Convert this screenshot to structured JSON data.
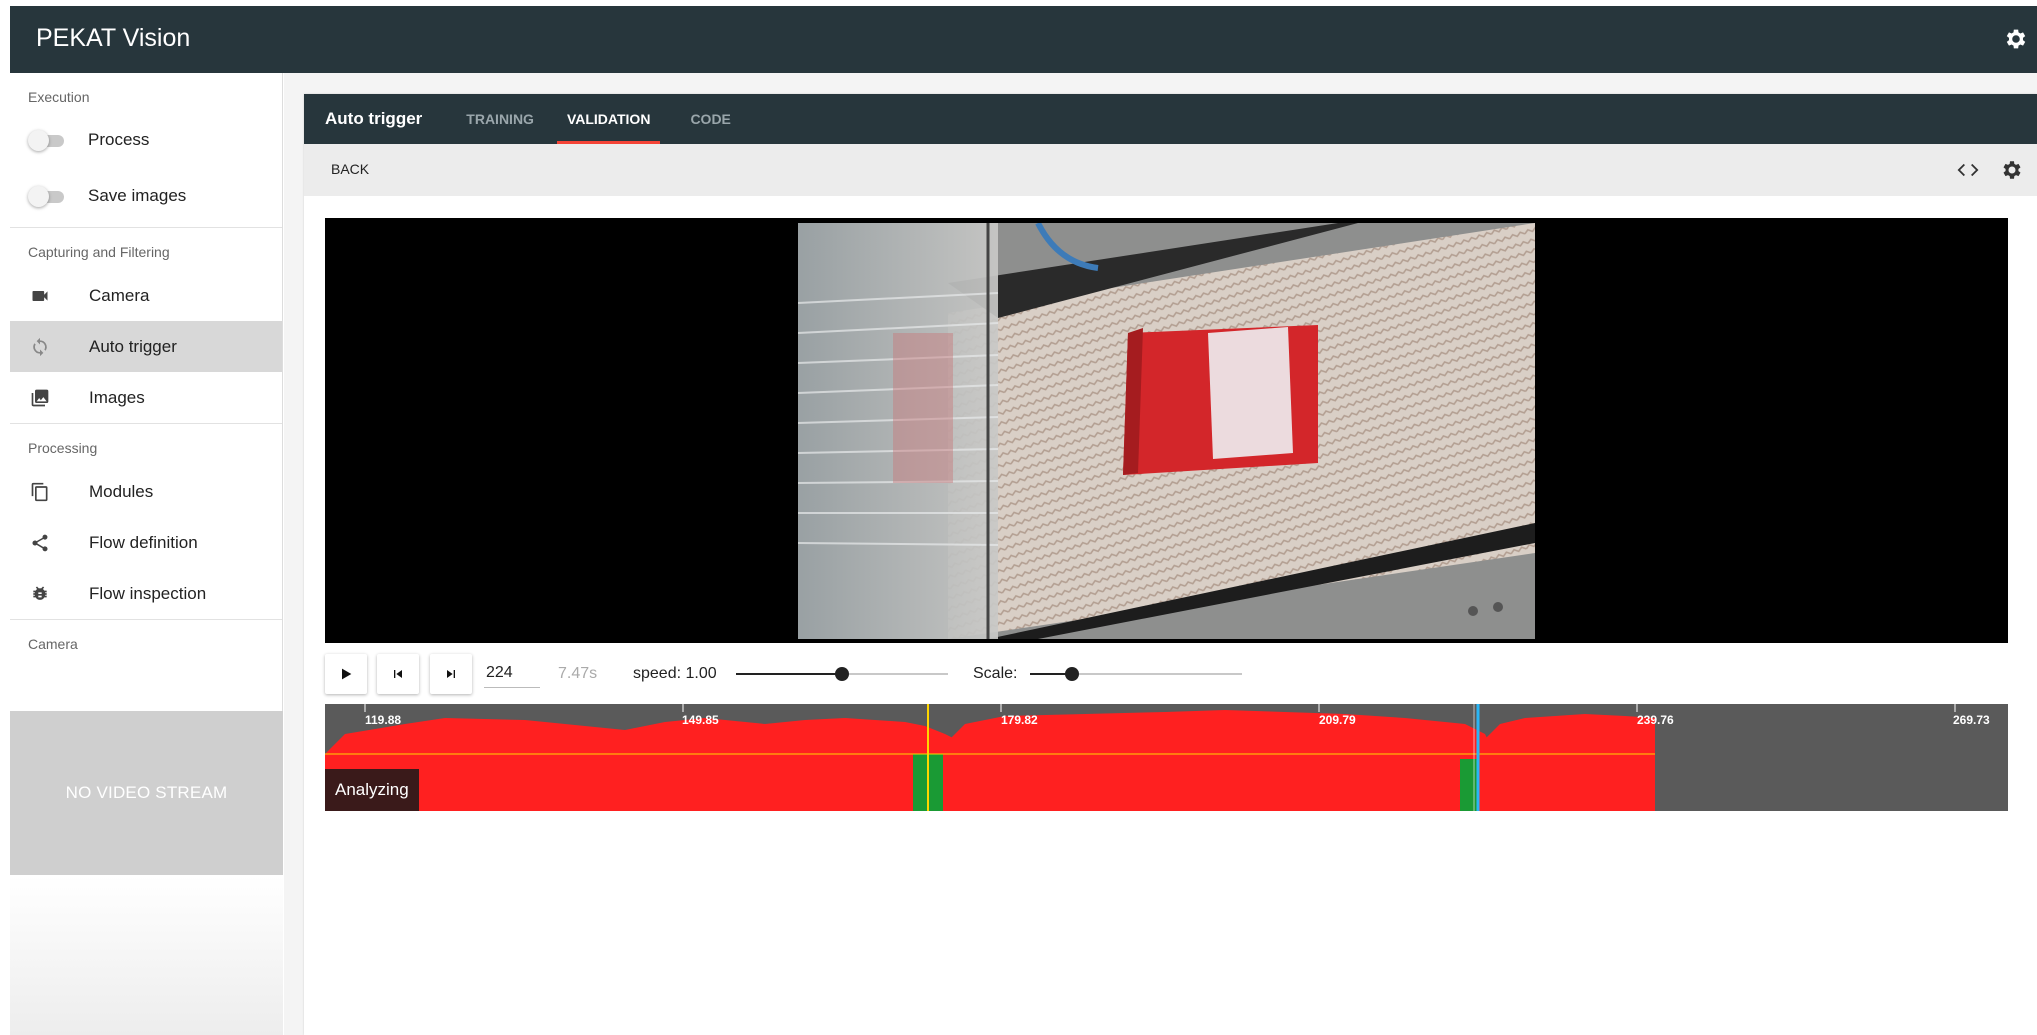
{
  "app": {
    "title": "PEKAT Vision"
  },
  "sidebar": {
    "sections": [
      {
        "title": "Execution"
      },
      {
        "title": "Capturing and Filtering"
      },
      {
        "title": "Processing"
      },
      {
        "title": "Camera"
      }
    ],
    "toggles": [
      {
        "label": "Process",
        "on": false
      },
      {
        "label": "Save images",
        "on": false
      }
    ],
    "capture_items": [
      {
        "label": "Camera",
        "icon": "videocam-icon"
      },
      {
        "label": "Auto trigger",
        "icon": "sync-icon",
        "active": true
      },
      {
        "label": "Images",
        "icon": "photo-library-icon"
      }
    ],
    "processing_items": [
      {
        "label": "Modules",
        "icon": "copy-icon"
      },
      {
        "label": "Flow definition",
        "icon": "share-icon"
      },
      {
        "label": "Flow inspection",
        "icon": "bug-icon"
      }
    ],
    "no_video": "NO VIDEO STREAM"
  },
  "panel": {
    "title": "Auto trigger",
    "tabs": [
      {
        "label": "TRAINING",
        "active": false
      },
      {
        "label": "VALIDATION",
        "active": true
      },
      {
        "label": "CODE",
        "active": false
      }
    ],
    "back_label": "BACK"
  },
  "player": {
    "frame": "224",
    "time": "7.47s",
    "speed_label": "speed: 1.00",
    "speed_value": 1.0,
    "scale_label": "Scale:"
  },
  "timeline": {
    "status": "Analyzing",
    "tick_labels": [
      "119.88",
      "149.85",
      "179.82",
      "209.79",
      "239.76",
      "269.73"
    ],
    "colors": {
      "anomaly": "#ff2020",
      "ok": "#1faa3a",
      "background": "#5a5a5a",
      "threshold": "#ffd600",
      "cursor": "#29b6f6"
    }
  },
  "colors": {
    "appbar": "#27363c",
    "accent": "#f44336"
  }
}
